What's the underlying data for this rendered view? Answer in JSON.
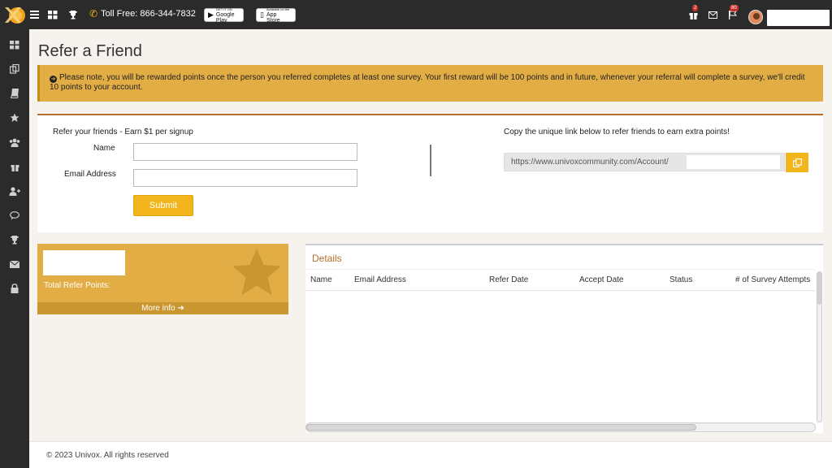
{
  "topbar": {
    "toll_free": "Toll Free: 866-344-7832",
    "google_play": {
      "small": "GET IT ON",
      "label": "Google Play"
    },
    "app_store": {
      "small": "Available on the",
      "label": "App Store"
    },
    "gift_badge": "2",
    "flag_badge": "80"
  },
  "sidebar": {
    "items": [
      {
        "icon": "dashboard-icon"
      },
      {
        "icon": "copy-icon"
      },
      {
        "icon": "book-icon"
      },
      {
        "icon": "star-icon"
      },
      {
        "icon": "users-icon"
      },
      {
        "icon": "gift-icon"
      },
      {
        "icon": "user-plus-icon"
      },
      {
        "icon": "comments-icon"
      },
      {
        "icon": "trophy-icon"
      },
      {
        "icon": "envelope-icon"
      },
      {
        "icon": "lock-icon"
      }
    ]
  },
  "page": {
    "title": "Refer a Friend",
    "notice": "Please note, you will be rewarded points once the person you referred completes at least one survey. Your first reward will be 100 points and in future, whenever your referral will complete a survey, we'll credit 10 points to your account."
  },
  "refer_form": {
    "heading": "Refer your friends - Earn $1 per signup",
    "name_label": "Name",
    "name_value": "",
    "email_label": "Email Address",
    "email_value": "",
    "submit_label": "Submit"
  },
  "unique_link": {
    "heading": "Copy the unique link below to refer friends to earn extra points!",
    "url": "https://www.univoxcommunity.com/Account/"
  },
  "points_card": {
    "label": "Total Refer Points:",
    "more_info": "More info"
  },
  "details": {
    "title": "Details",
    "columns": [
      "Name",
      "Email Address",
      "Refer Date",
      "Accept Date",
      "Status",
      "# of Survey Attempts"
    ]
  },
  "footer": {
    "text": "© 2023 Univox. All rights reserved"
  },
  "colors": {
    "topbar": "#2b2b2b",
    "accent": "#f2b51c",
    "notice_bg": "#e2ad45",
    "panel_border": "#b5702e"
  }
}
